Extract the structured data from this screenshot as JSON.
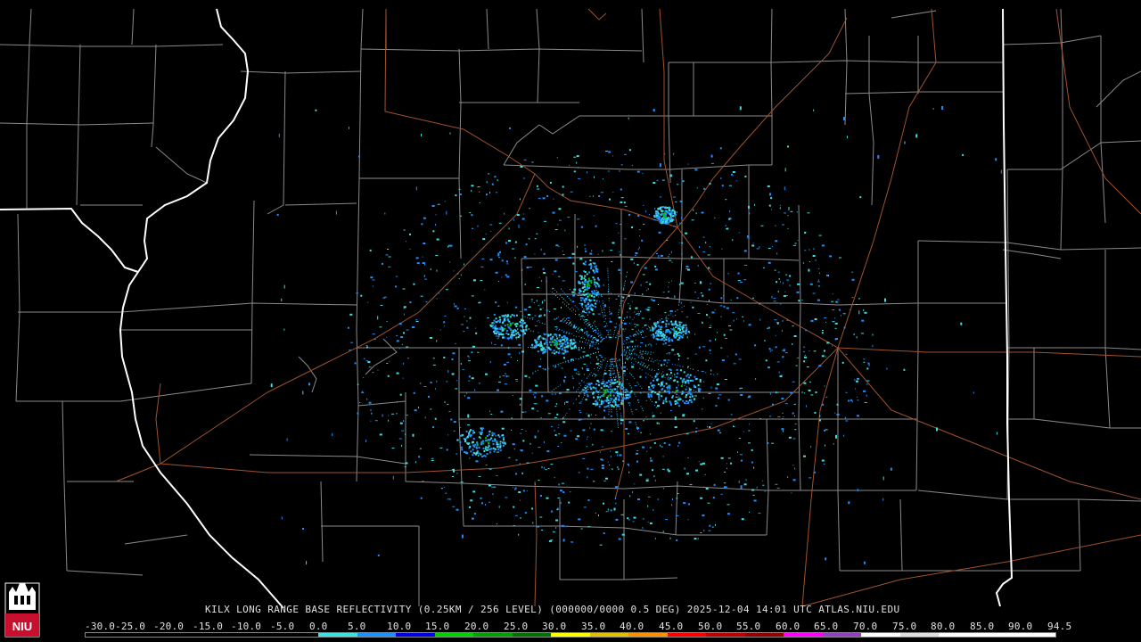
{
  "caption": "KILX LONG RANGE BASE REFLECTIVITY (0.25KM / 256 LEVEL) (000000/0000 0.5 DEG) 2025-12-04 14:01 UTC  ATLAS.NIU.EDU",
  "logo": {
    "text": "NIU",
    "icon": "niu-tower-logo"
  },
  "legend": {
    "labels": [
      "-30.0",
      "-25.0",
      "-20.0",
      "-15.0",
      "-10.0",
      "-5.0",
      "0.0",
      "5.0",
      "10.0",
      "15.0",
      "20.0",
      "25.0",
      "30.0",
      "35.0",
      "40.0",
      "45.0",
      "50.0",
      "55.0",
      "60.0",
      "65.0",
      "70.0",
      "75.0",
      "80.0",
      "85.0",
      "90.0",
      "94.5"
    ],
    "colors": [
      "#000000",
      "#000000",
      "#000000",
      "#000000",
      "#000000",
      "#000000",
      "#40e0e0",
      "#1e90ff",
      "#0000e0",
      "#00d000",
      "#00a000",
      "#007000",
      "#ffff00",
      "#e0c000",
      "#ff9000",
      "#ff0000",
      "#c00000",
      "#900000",
      "#ff00ff",
      "#9040c0",
      "#ffffff",
      "#e0e0e0",
      "#ffffff",
      "#ffffff",
      "#ffffff"
    ]
  },
  "colors": {
    "background": "#000000",
    "county_lines": "#8a8a8a",
    "state_lines": "#ffffff",
    "highways": "#a0522d",
    "echo_weak": "#1e90ff",
    "echo_light": "#40e0e0",
    "echo_moderate": "#00c000"
  }
}
